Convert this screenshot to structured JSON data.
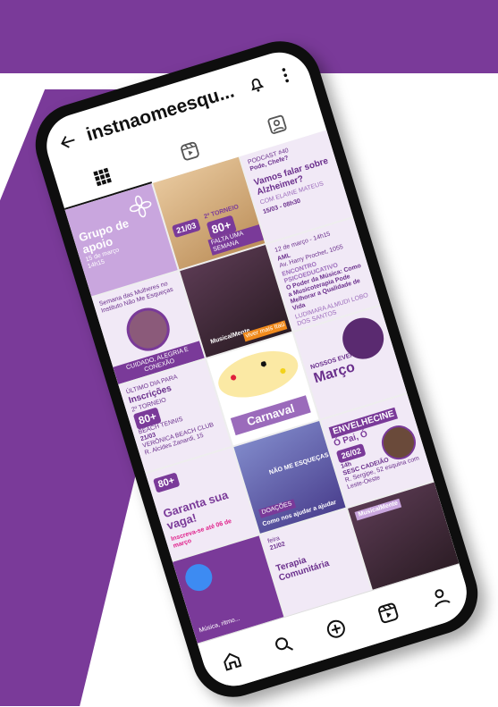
{
  "header": {
    "title": "instnaomeesqu..."
  },
  "tabs": [
    {
      "name": "grid-tab",
      "icon": "grid-icon"
    },
    {
      "name": "reels-tab",
      "icon": "reels-icon"
    },
    {
      "name": "tagged-tab",
      "icon": "tagged-icon"
    }
  ],
  "posts": {
    "p1": {
      "title": "Grupo de apoio",
      "date": "15 de março",
      "time": "14h15"
    },
    "p2": {
      "date": "21/03",
      "badge": "80+",
      "tag": "FALTA UMA SEMANA",
      "caption": "2º TORNEIO"
    },
    "p3": {
      "kicker": "PODCAST #40",
      "show": "Pode, Chefe?",
      "title": "Vamos falar sobre Alzheimer?",
      "guest": "COM ELAINE MATEUS",
      "datetime": "15/03 - 08h30"
    },
    "p4": {
      "line1": "Semana das Mulheres no Instituto Não Me Esqueças",
      "footer": "CUIDADO, ALEGRIA E CONEXÃO"
    },
    "p5": {
      "brand": "MusicalMente",
      "sponsor": "viver mais Itaú"
    },
    "p6": {
      "date": "12 de março - 14h15",
      "org": "AML",
      "addr": "Av. Harry Prochet, 1055",
      "kicker": "ENCONTRO PSICOEDUCATIVO",
      "title": "O Poder da Música: Como a Musicoterapia Pode Melhorar a Qualidade de Vida",
      "names": "LUDIMARA ALMUDI LOBO DOS SANTOS"
    },
    "p7": {
      "kicker": "ÚLTIMO DIA PARA",
      "title": "Inscrições",
      "caption": "2º TORNEIO",
      "badge": "80+",
      "sub": "BEACH TENNIS",
      "date": "21/03",
      "place": "VERÔNICA BEACH CLUB",
      "addr": "R. Alcides Zanardi, 15"
    },
    "p8": {
      "title": "Carnaval"
    },
    "p9": {
      "kicker": "NOSSOS EVENTOS",
      "month": "Março"
    },
    "p10": {
      "title": "Garanta sua vaga!",
      "sub": "Inscreva-se até 06 de março",
      "badge": "80+"
    },
    "p11": {
      "kicker": "DOAÇÕES",
      "line": "Como nos ajudar a ajudar",
      "brand": "NÃO ME ESQUEÇAS"
    },
    "p12": {
      "title": "ENVELHECINE",
      "film": "Ó Pai, Ó",
      "date": "26/02",
      "time": "14h",
      "place": "SESC CADEIÃO",
      "addr": "R. Sergipe, 52 esquina com Leste-Oeste"
    },
    "p13": {
      "caption": "Música, ritmo..."
    },
    "p14": {
      "day": "feira",
      "date": "21/02",
      "title": "Terapia Comunitária"
    },
    "p15": {
      "brand": "MusicalMente"
    }
  },
  "nav": [
    {
      "name": "home-icon"
    },
    {
      "name": "search-icon"
    },
    {
      "name": "create-icon"
    },
    {
      "name": "reels-icon"
    },
    {
      "name": "profile-icon"
    }
  ],
  "colors": {
    "brand_purple": "#7a3a99",
    "light_lilac": "#f1e9f6",
    "accent_blue": "#3d8bf2"
  }
}
